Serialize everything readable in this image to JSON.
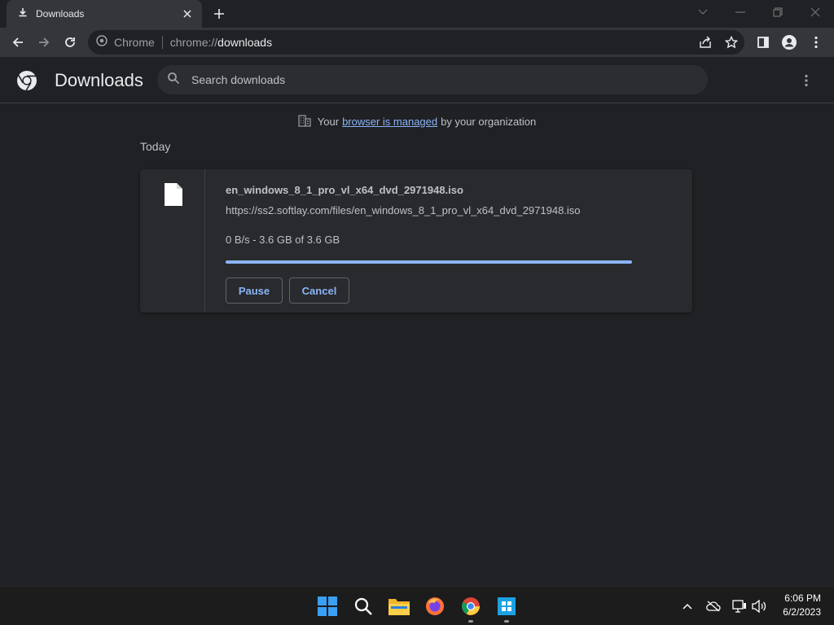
{
  "tab": {
    "title": "Downloads"
  },
  "omnibox": {
    "site_label": "Chrome",
    "url_scheme": "chrome://",
    "url_host": "downloads"
  },
  "page": {
    "title": "Downloads",
    "search_placeholder": "Search downloads",
    "managed_prefix": "Your",
    "managed_link": "browser is managed",
    "managed_suffix": "by your organization",
    "section": "Today"
  },
  "download": {
    "file_name": "en_windows_8_1_pro_vl_x64_dvd_2971948.iso",
    "url": "https://ss2.softlay.com/files/en_windows_8_1_pro_vl_x64_dvd_2971948.iso",
    "status": "0 B/s - 3.6 GB of 3.6 GB",
    "progress_fraction": 1.0,
    "pause_label": "Pause",
    "cancel_label": "Cancel"
  },
  "colors": {
    "accent": "#8ab4f8",
    "background": "#202124",
    "card": "#292a2d"
  },
  "taskbar": {
    "apps": [
      "start-icon",
      "search-icon",
      "file-explorer-icon",
      "firefox-icon",
      "chrome-icon",
      "windows-store-icon"
    ],
    "time": "6:06 PM",
    "date": "6/2/2023"
  }
}
